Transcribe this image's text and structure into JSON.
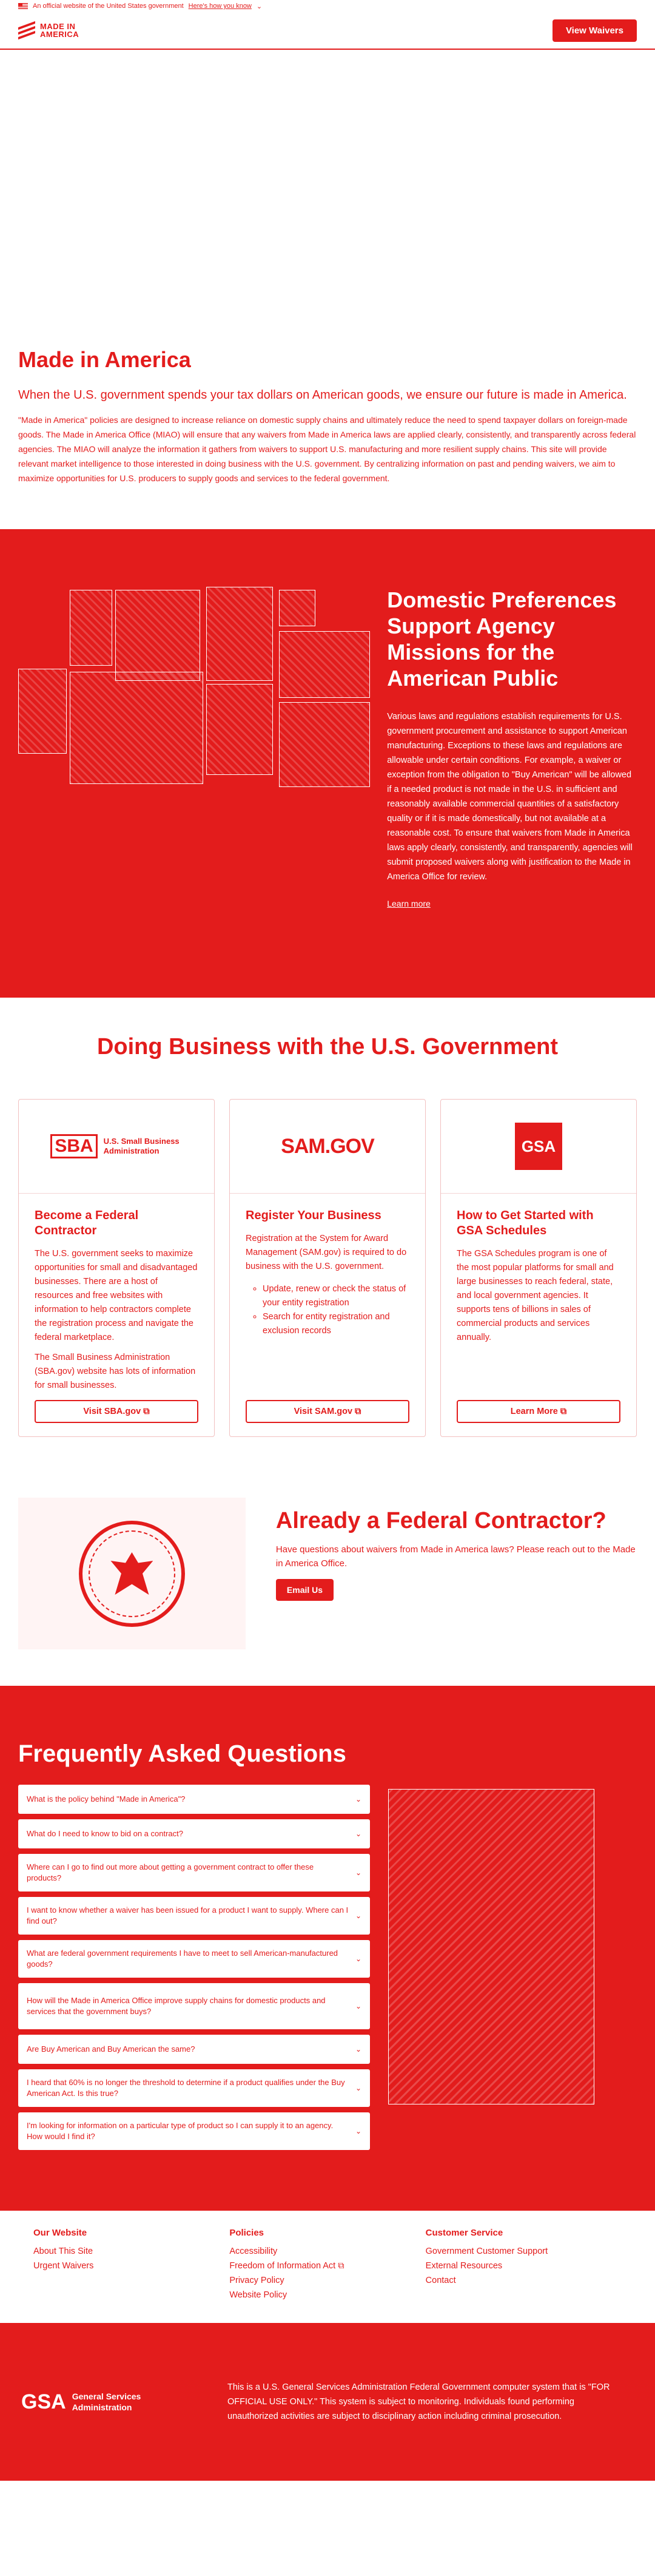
{
  "gov_banner": {
    "text": "An official website of the United States government",
    "link": "Here's how you know"
  },
  "header": {
    "logo_line1": "MADE IN",
    "logo_line2": "AMERICA",
    "cta": "View Waivers"
  },
  "intro": {
    "title": "Made in America",
    "lead": "When the U.S. government spends your tax dollars on American goods, we ensure our future is made in America.",
    "body": "\"Made in America\" policies are designed to increase reliance on domestic supply chains and ultimately reduce the need to spend taxpayer dollars on foreign-made goods. The Made in America Office (MIAO) will ensure that any waivers from Made in America laws are applied clearly, consistently, and transparently across federal agencies. The MIAO will analyze the information it gathers from waivers to support U.S. manufacturing and more resilient supply chains. This site will provide relevant market intelligence to those interested in doing business with the U.S. government. By centralizing information on past and pending waivers, we aim to maximize opportunities for U.S. producers to supply goods and services to the federal government."
  },
  "domestic": {
    "title": "Domestic Preferences Support Agency Missions for the American Public",
    "body": "Various laws and regulations establish requirements for U.S. government procurement and assistance to support American manufacturing. Exceptions to these laws and regulations are allowable under certain conditions. For example, a waiver or exception from the obligation to \"Buy American\" will be allowed if a needed product is not made in the U.S. in sufficient and reasonably available commercial quantities of a satisfactory quality or if it is made domestically, but not available at a reasonable cost. To ensure that waivers from Made in America laws apply clearly, consistently, and transparently, agencies will submit proposed waivers along with justification to the Made in America Office for review.",
    "link": "Learn more"
  },
  "doing_business": {
    "title": "Doing Business with the U.S. Government",
    "cards": [
      {
        "logo_mark": "SBA",
        "logo_text": "U.S. Small Business Administration",
        "title": "Become a Federal Contractor",
        "paragraphs": [
          "The U.S. government seeks to maximize opportunities for small and disadvantaged businesses. There are a host of resources and free websites with information to help contractors complete the registration process and navigate the federal marketplace.",
          "The Small Business Administration (SBA.gov) website has lots of information for small businesses."
        ],
        "bullets": [],
        "button": "Visit SBA.gov ⧉"
      },
      {
        "logo_mark": "SAM.GOV",
        "logo_text": "",
        "title": "Register Your Business",
        "paragraphs": [
          "Registration at the System for Award Management (SAM.gov) is required to do business with the U.S. government."
        ],
        "bullets": [
          "Update, renew or check the status of your entity registration",
          "Search for entity registration and exclusion records"
        ],
        "button": "Visit SAM.gov ⧉"
      },
      {
        "logo_mark": "GSA",
        "logo_text": "",
        "title": "How to Get Started with GSA Schedules",
        "paragraphs": [
          "The GSA Schedules program is one of the most popular platforms for small and large businesses to reach federal, state, and local government agencies. It supports tens of billions in sales of commercial products and services annually."
        ],
        "bullets": [],
        "button": "Learn More ⧉"
      }
    ]
  },
  "already": {
    "title": "Already a Federal Contractor?",
    "body": "Have questions about waivers from Made in America laws? Please reach out to the Made in America Office.",
    "button": "Email Us"
  },
  "faq": {
    "title": "Frequently Asked Questions",
    "items": [
      "What is the policy behind \"Made in America\"?",
      "What do I need to know to bid on a contract?",
      "Where can I go to find out more about getting a government contract to offer these products?",
      "I want to know whether a waiver has been issued for a product I want to supply. Where can I find out?",
      "What are federal government requirements I have to meet to sell American-manufactured goods?",
      "How will the Made in America Office improve supply chains for domestic products and services that the government buys?",
      "Are Buy American and Buy American the same?",
      "I heard that 60% is no longer the threshold to determine if a product qualifies under the Buy American Act. Is this true?",
      "I'm looking for information on a particular type of product so I can supply it to an agency. How would I find it?"
    ]
  },
  "footer": {
    "columns": [
      {
        "heading": "Our Website",
        "links": [
          "About This Site",
          "Urgent Waivers"
        ]
      },
      {
        "heading": "Policies",
        "links": [
          "Accessibility",
          "Freedom of Information Act ⧉",
          "Privacy Policy",
          "Website Policy"
        ]
      },
      {
        "heading": "Customer Service",
        "links": [
          "Government Customer Support",
          "External Resources",
          "Contact"
        ]
      }
    ],
    "gsa_mark": "GSA",
    "gsa_line1": "General Services",
    "gsa_line2": "Administration",
    "disclaimer": "This is a U.S. General Services Administration Federal Government computer system that is \"FOR OFFICIAL USE ONLY.\" This system is subject to monitoring. Individuals found performing unauthorized activities are subject to disciplinary action including criminal prosecution."
  }
}
